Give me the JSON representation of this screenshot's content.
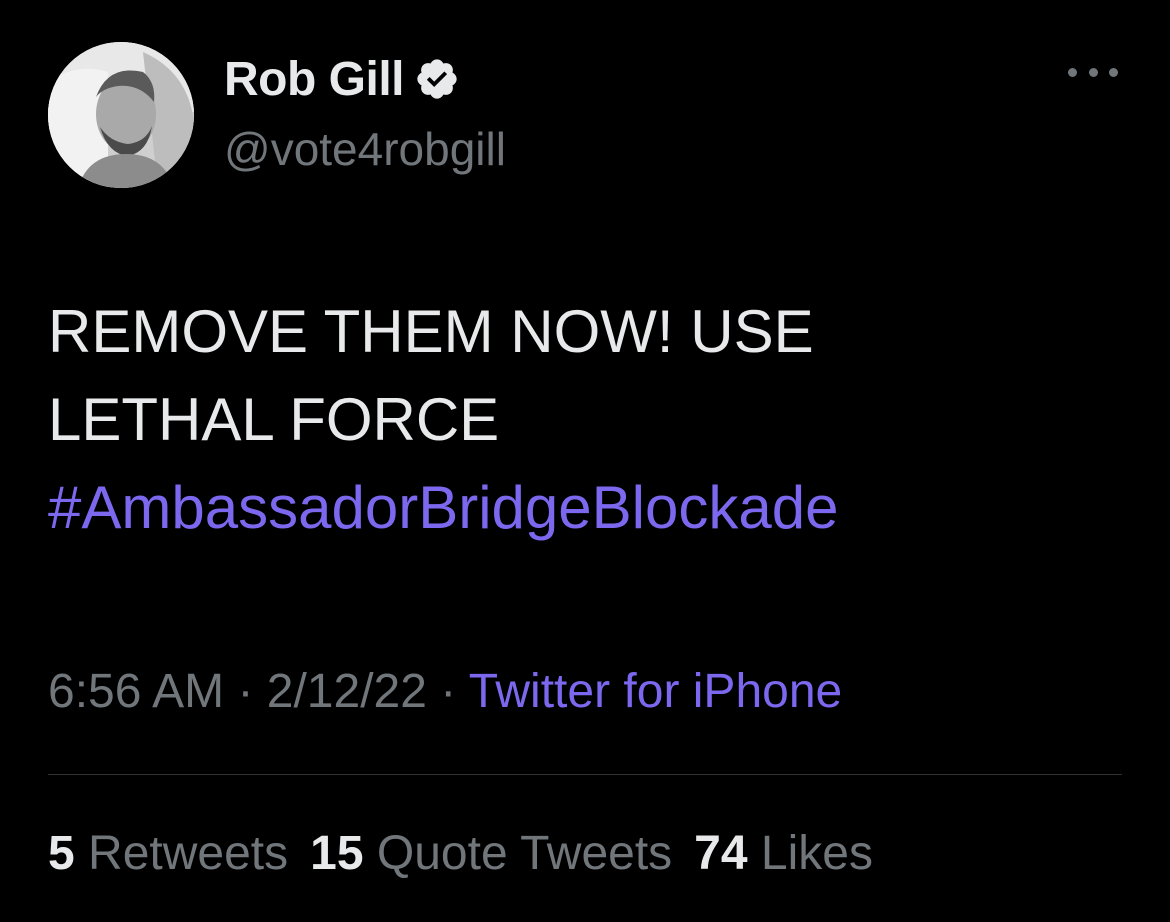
{
  "author": {
    "display_name": "Rob Gill",
    "handle": "@vote4robgill",
    "verified": true
  },
  "tweet": {
    "lines": [
      "REMOVE THEM NOW! USE",
      "LETHAL FORCE"
    ],
    "hashtag": "#AmbassadorBridgeBlockade"
  },
  "meta": {
    "time": "6:56 AM",
    "sep1": " · ",
    "date": "2/12/22",
    "sep2": " · ",
    "source": "Twitter for iPhone"
  },
  "stats": {
    "retweets_count": "5",
    "retweets_label": "Retweets",
    "quotes_count": "15",
    "quotes_label": "Quote Tweets",
    "likes_count": "74",
    "likes_label": "Likes"
  },
  "icons": {
    "more": "more-horizontal-icon",
    "verified": "verified-badge-icon"
  },
  "colors": {
    "background": "#000000",
    "text": "#e7e9ea",
    "secondary": "#71767b",
    "link": "#7b68ee"
  }
}
